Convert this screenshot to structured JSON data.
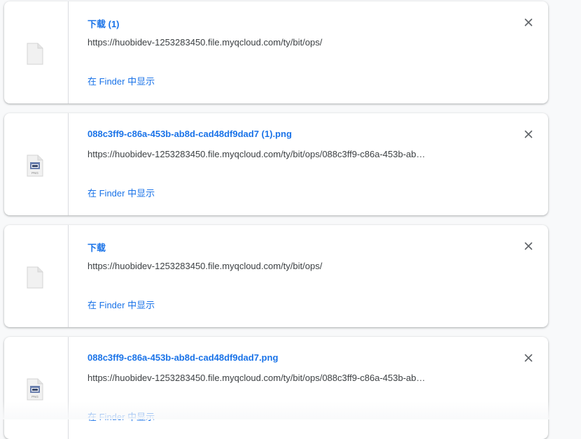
{
  "downloads": [
    {
      "file_name": "下载 (1)",
      "url": "https://huobidev-1253283450.file.myqcloud.com/ty/bit/ops/",
      "show_in_finder": "在 Finder 中显示",
      "icon": "generic-file-icon"
    },
    {
      "file_name": "088c3ff9-c86a-453b-ab8d-cad48df9dad7 (1).png",
      "url": "https://huobidev-1253283450.file.myqcloud.com/ty/bit/ops/088c3ff9-c86a-453b-ab…",
      "show_in_finder": "在 Finder 中显示",
      "icon": "png-file-icon"
    },
    {
      "file_name": "下载",
      "url": "https://huobidev-1253283450.file.myqcloud.com/ty/bit/ops/",
      "show_in_finder": "在 Finder 中显示",
      "icon": "generic-file-icon"
    },
    {
      "file_name": "088c3ff9-c86a-453b-ab8d-cad48df9dad7.png",
      "url": "https://huobidev-1253283450.file.myqcloud.com/ty/bit/ops/088c3ff9-c86a-453b-ab…",
      "show_in_finder": "在 Finder 中显示",
      "icon": "png-file-icon"
    }
  ],
  "png_icon_label": "PNG",
  "colors": {
    "link": "#1a73e8",
    "text": "#3c4043",
    "background": "#f8f9fa",
    "card": "#ffffff"
  }
}
